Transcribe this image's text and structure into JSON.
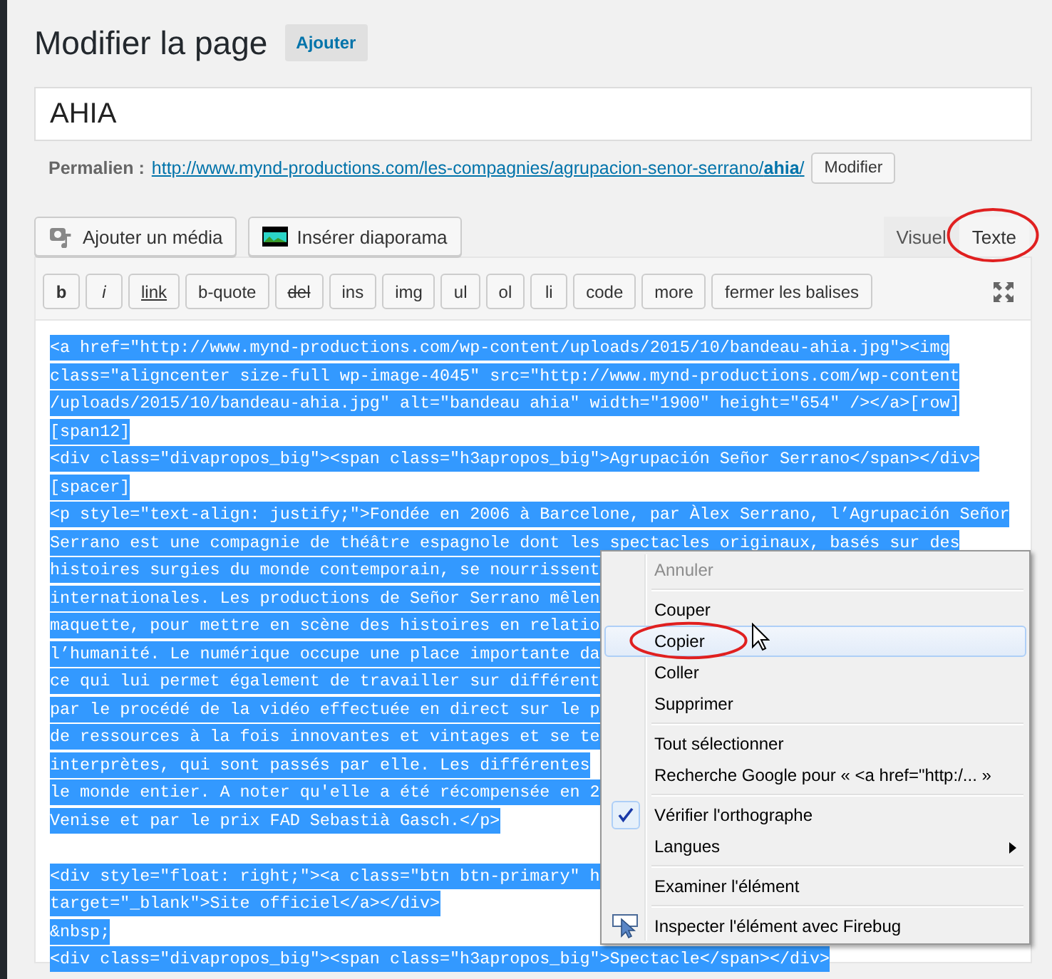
{
  "page_title": "Modifier la page",
  "add_button": "Ajouter",
  "title_field": {
    "value": "AHIA"
  },
  "permalink": {
    "label": "Permalien :",
    "url": "http://www.mynd-productions.com/les-compagnies/agrupacion-senor-serrano/**ahia**/",
    "button": "Modifier"
  },
  "media_buttons": [
    {
      "label": "Ajouter un média",
      "kind": "media"
    },
    {
      "label": "Insérer diaporama",
      "kind": "slideshow"
    }
  ],
  "editor_tabs": [
    {
      "label": "Visuel",
      "selected": false,
      "circled": false
    },
    {
      "label": "Texte",
      "selected": true,
      "circled": true
    }
  ],
  "quicktags": [
    "b",
    "i",
    "link",
    "b-quote",
    "del",
    "ins",
    "img",
    "ul",
    "ol",
    "li",
    "code",
    "more",
    "fermer les balises"
  ],
  "code": {
    "selected": true,
    "blocks": [
      [
        "<a href=\"http://www.mynd-productions.com/wp-content/uploads/2015/10/bandeau-ahia.jpg\"><img",
        "class=\"aligncenter size-full wp-image-4045\" src=\"http://www.mynd-productions.com/wp-content",
        "/uploads/2015/10/bandeau-ahia.jpg\" alt=\"bandeau ahia\" width=\"1900\" height=\"654\" /></a>[row]",
        "[span12]",
        "<div class=\"divapropos_big\"><span class=\"h3apropos_big\">Agrupación Señor Serrano</span></div>",
        "[spacer]",
        "<p style=\"text-align: justify;\">Fondée en 2006 à Barcelone, par Àlex Serrano, l’Agrupación Señor",
        "Serrano est une compagnie de théâtre espagnole dont les spectacles originaux, basés sur des",
        "histoires surgies du monde contemporain, se nourrissent",
        "internationales. Les productions de Señor Serrano mêlen",
        "maquette, pour mettre en scène des histoires en relatio",
        "l’humanité. Le numérique occupe une place importante da",
        "ce qui lui permet également de travailler sur différent",
        "par le procédé de la vidéo effectuée en direct sur le p",
        "de ressources à la fois innovantes et vintages et se te",
        "interprètes, qui sont passés par elle. Les différentes",
        "le monde entier. A noter qu'elle a été récompensée en 2",
        "Venise et par le prix FAD Sebastià Gasch.</p>"
      ],
      [
        "<div style=\"float: right;\"><a class=\"btn btn-primary\" h",
        "target=\"_blank\">Site officiel</a></div>",
        "&nbsp;",
        "<div class=\"divapropos_big\"><span class=\"h3apropos_big\">Spectacle</span></div>"
      ]
    ]
  },
  "context_menu": {
    "groups": [
      [
        {
          "label": "Annuler",
          "kind": "plain",
          "disabled": true,
          "highlighted": false,
          "checked": false,
          "submenu": false,
          "circled": false
        }
      ],
      [
        {
          "label": "Couper",
          "kind": "plain",
          "disabled": false,
          "highlighted": false,
          "checked": false,
          "submenu": false,
          "circled": false
        },
        {
          "label": "Copier",
          "kind": "plain",
          "disabled": false,
          "highlighted": true,
          "checked": false,
          "submenu": false,
          "circled": true
        },
        {
          "label": "Coller",
          "kind": "plain",
          "disabled": false,
          "highlighted": false,
          "checked": false,
          "submenu": false,
          "circled": false
        },
        {
          "label": "Supprimer",
          "kind": "plain",
          "disabled": false,
          "highlighted": false,
          "checked": false,
          "submenu": false,
          "circled": false
        }
      ],
      [
        {
          "label": "Tout sélectionner",
          "kind": "plain",
          "disabled": false,
          "highlighted": false,
          "checked": false,
          "submenu": false,
          "circled": false
        },
        {
          "label": "Recherche Google pour « <a href=\"http:/... »",
          "kind": "plain",
          "disabled": false,
          "highlighted": false,
          "checked": false,
          "submenu": false,
          "circled": false
        }
      ],
      [
        {
          "label": "Vérifier l'orthographe",
          "kind": "plain",
          "disabled": false,
          "highlighted": false,
          "checked": true,
          "submenu": false,
          "circled": false
        },
        {
          "label": "Langues",
          "kind": "plain",
          "disabled": false,
          "highlighted": false,
          "checked": false,
          "submenu": true,
          "circled": false
        }
      ],
      [
        {
          "label": "Examiner l'élément",
          "kind": "plain",
          "disabled": false,
          "highlighted": false,
          "checked": false,
          "submenu": false,
          "circled": false
        }
      ],
      [
        {
          "label": "Inspecter l'élément avec Firebug",
          "kind": "firebug",
          "disabled": false,
          "highlighted": false,
          "checked": false,
          "submenu": false,
          "circled": false
        }
      ]
    ]
  }
}
